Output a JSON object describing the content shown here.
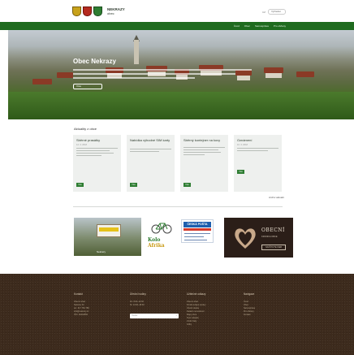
{
  "header": {
    "logo_title": "NEKRAZY",
    "logo_subtitle": "obec",
    "lang": "CZ",
    "search_placeholder": "Vyhledat"
  },
  "nav": {
    "items": [
      "Úvod",
      "Obec",
      "Samospráva",
      "Pro občany"
    ]
  },
  "hero": {
    "title": "Obec Nekrazy",
    "button_label": "Více"
  },
  "news": {
    "heading": "Aktuality z obce",
    "cards": [
      {
        "title": "Sběrné prasátky",
        "date": "12. 3. 2018",
        "button": "Více"
      },
      {
        "title": "Nabídka výhodné SIM karty",
        "date": "",
        "button": "Více"
      },
      {
        "title": "Sběrný kontejner na kovy",
        "date": "",
        "button": "Více"
      },
      {
        "title": "Oznámení",
        "date": "10. 3. 2018",
        "button": "Více"
      }
    ],
    "archive_link": "Archiv aktualit"
  },
  "banners": {
    "b1_label": "Nekrazy",
    "b2_line1": "Kolo",
    "b2_line2": "Afrika",
    "b3_title": "ČESKÁ POŠTA",
    "b4_title": "OBECNÍ",
    "b4_sub": "KRONIKA OBCE",
    "b4_box": "NAVŠTIVTE WEB"
  },
  "footer": {
    "col1": {
      "heading": "Kontakt",
      "lines": [
        "Obecní úřad",
        "Nekrazy 31",
        "tel.: 317 781 789",
        "info@nekrazy.cz",
        "",
        "IČO: 00232556"
      ]
    },
    "col2": {
      "heading": "Úřední hodiny",
      "lines": [
        "Po: 8:00–12:00",
        "St: 14:00–18:00"
      ],
      "search_placeholder": "Hledat"
    },
    "col3": {
      "heading": "Užitečné odkazy",
      "lines": [
        "Obecní úřad",
        "Portál veřejné správy",
        "Úřední deska",
        "Katastr nemovitostí",
        "Mapy obce",
        "Svoz odpadu",
        "Jízdní řády",
        "Volby"
      ]
    },
    "col4": {
      "heading": "Navigace",
      "lines": [
        "Úvod",
        "Obec",
        "Samospráva",
        "Pro občany",
        "Kontakt"
      ]
    }
  },
  "colors": {
    "nav_green": "#1f6b1f",
    "button_green": "#2e7d32",
    "footer_brown": "#3d2b1d"
  }
}
